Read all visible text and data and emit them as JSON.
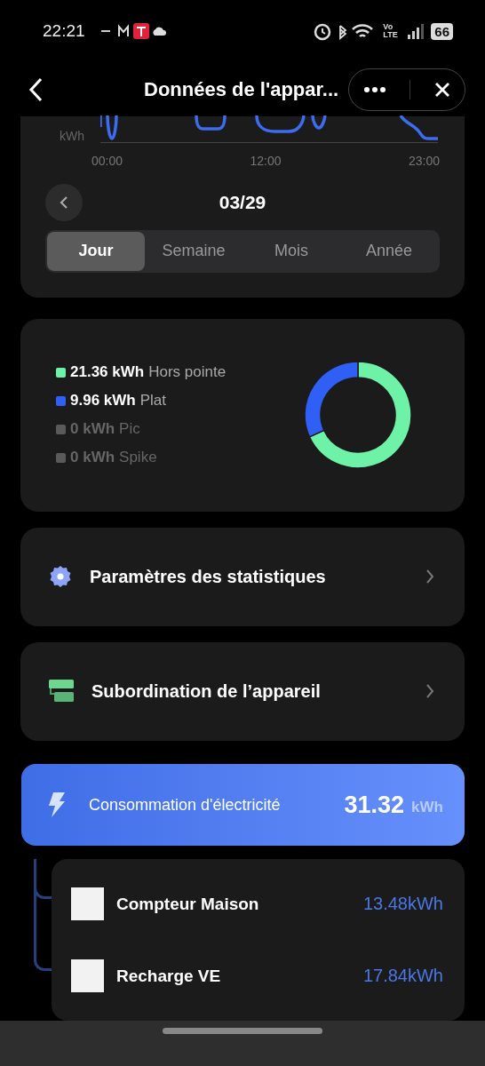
{
  "status_bar": {
    "time": "22:21",
    "network_label": "Vo\nLTE",
    "battery": "66"
  },
  "header": {
    "title": "Données de l'appar..."
  },
  "usage_chart": {
    "y_unit": "kWh",
    "x_labels": [
      "00:00",
      "12:00",
      "23:00"
    ]
  },
  "date_nav": {
    "date": "03/29"
  },
  "period_tabs": [
    {
      "label": "Jour",
      "selected": true
    },
    {
      "label": "Semaine",
      "selected": false
    },
    {
      "label": "Mois",
      "selected": false
    },
    {
      "label": "Année",
      "selected": false
    }
  ],
  "tariff_legend": [
    {
      "value": "21.36 kWh",
      "label": "Hors pointe",
      "color": "#6ef2a8",
      "muted": false
    },
    {
      "value": "9.96 kWh",
      "label": "Plat",
      "color": "#2f5ff5",
      "muted": false
    },
    {
      "value": "0 kWh",
      "label": "Pic",
      "color": "#5a5a5a",
      "muted": true
    },
    {
      "value": "0 kWh",
      "label": "Spike",
      "color": "#5a5a5a",
      "muted": true
    }
  ],
  "tariff_chart": {
    "chart_data": {
      "type": "donut",
      "values": [
        68.2,
        31.8,
        0,
        0
      ]
    }
  },
  "menu_items": [
    {
      "kind": "settings",
      "label": "Paramètres des statistiques"
    },
    {
      "kind": "hierarchy",
      "label": "Subordination de l’appareil"
    }
  ],
  "consumption": {
    "label": "Consommation d'électricité",
    "value": "31.32",
    "unit": "kWh",
    "devices": [
      {
        "name": "Compteur Maison",
        "value": "13.48kWh"
      },
      {
        "name": "Recharge VE",
        "value": "17.84kWh"
      }
    ]
  }
}
